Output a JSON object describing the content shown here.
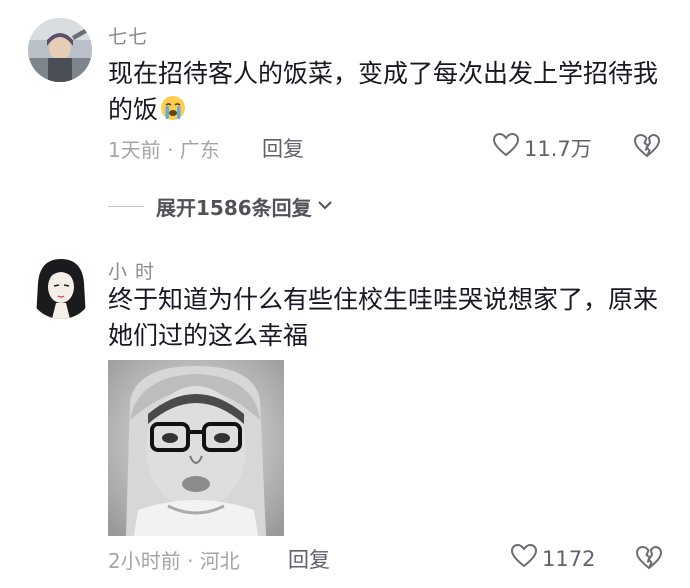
{
  "comments": [
    {
      "username": "七七",
      "text": "现在招待客人的饭菜，变成了每次出发上学招待我的饭",
      "emoji": "loudly-crying-face",
      "meta": "1天前 · 广东",
      "reply_label": "回复",
      "likes": "11.7万"
    },
    {
      "username": "小 时",
      "text": "终于知道为什么有些住校生哇哇哭说想家了，原来她们过的这么幸福",
      "meta": "2小时前 · 河北",
      "reply_label": "回复",
      "likes": "1172"
    }
  ],
  "expand_replies": "展开1586条回复",
  "colors": {
    "text": "#161823",
    "secondary": "#8a8b91",
    "meta": "#a4a5aa",
    "action": "#60626b"
  }
}
